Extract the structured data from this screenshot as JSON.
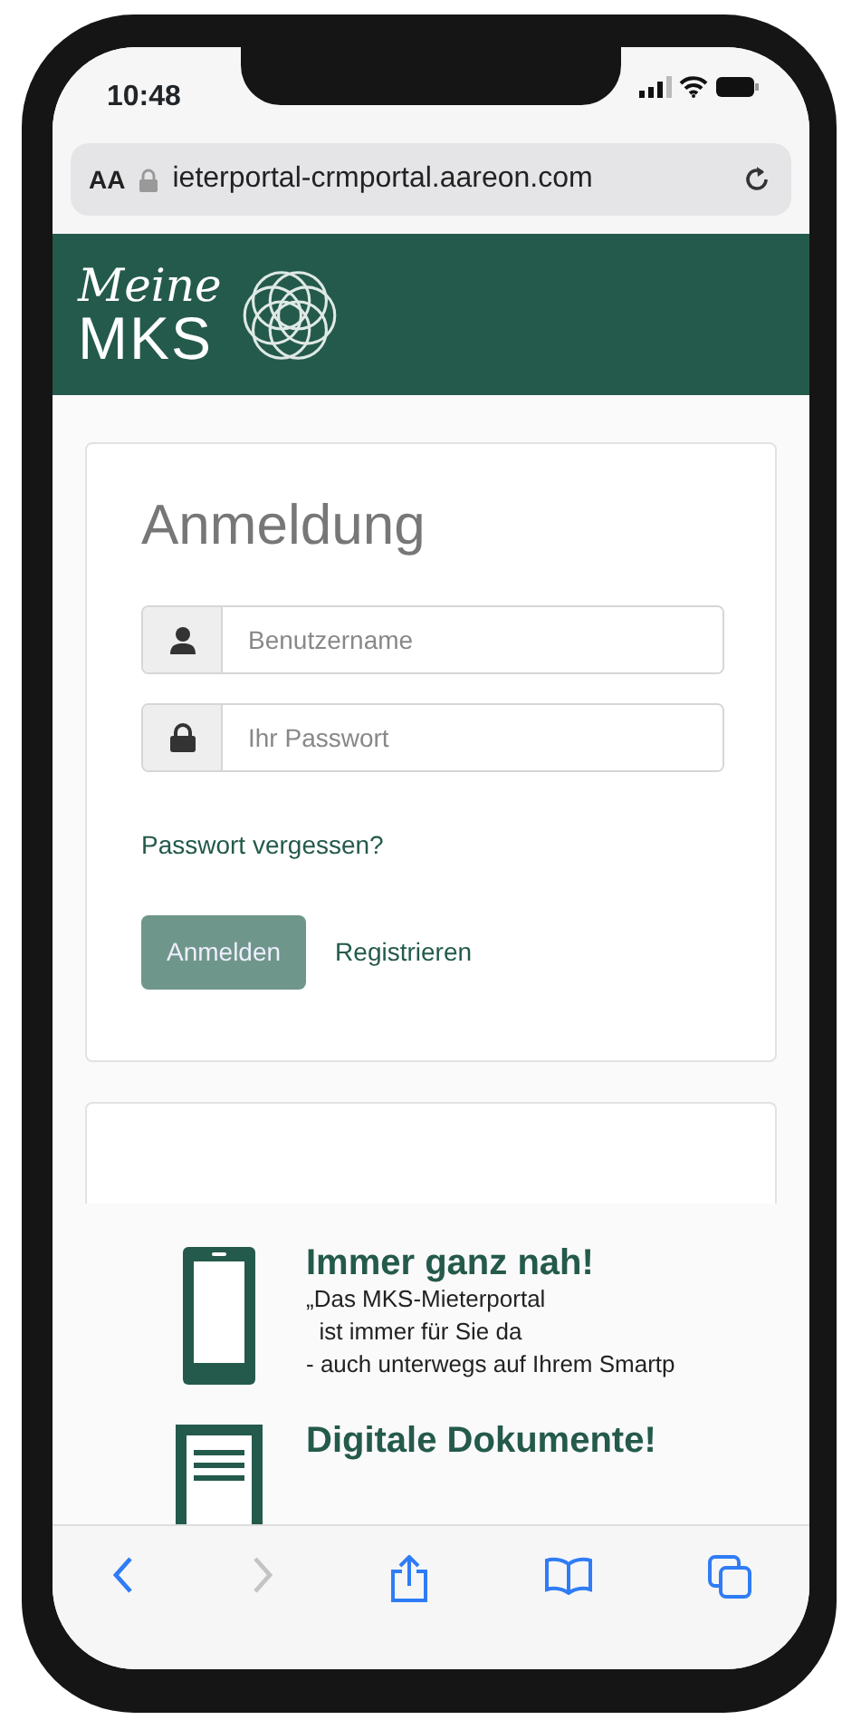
{
  "status_bar": {
    "time": "10:48"
  },
  "address_bar": {
    "text_size_label": "AA",
    "url": "ieterportal-crmportal.aareon.com"
  },
  "header": {
    "logo_script": "Meine",
    "logo_text": "MKS"
  },
  "login": {
    "title": "Anmeldung",
    "fields": [
      {
        "kind": "user",
        "placeholder": "Benutzername"
      },
      {
        "kind": "password",
        "placeholder": "Ihr Passwort"
      }
    ],
    "forgot_link": "Passwort vergessen?",
    "submit": "Anmelden",
    "register": "Registrieren"
  },
  "features": [
    {
      "kind": "phone",
      "title": "Immer ganz nah!",
      "lines": [
        "„Das MKS-Mieterportal",
        "  ist immer für Sie da",
        "- auch unterwegs auf Ihrem Smartp"
      ]
    },
    {
      "kind": "document",
      "title": "Digitale Dokumente!"
    }
  ],
  "toolbar": [
    {
      "kind": "back",
      "disabled": false
    },
    {
      "kind": "forward",
      "disabled": true
    },
    {
      "kind": "share",
      "disabled": false
    },
    {
      "kind": "bookmarks",
      "disabled": false
    },
    {
      "kind": "tabs",
      "disabled": false
    }
  ]
}
